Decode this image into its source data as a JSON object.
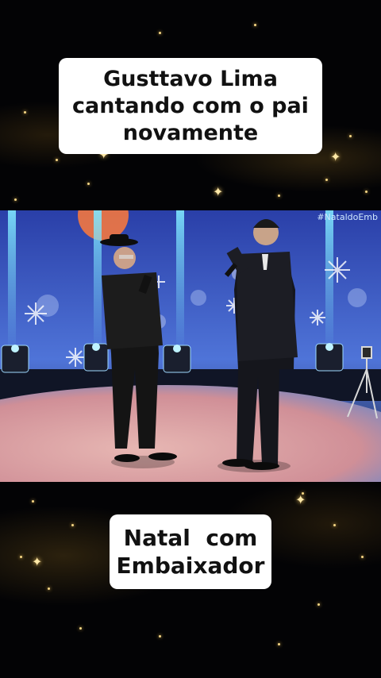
{
  "captions": {
    "top": "Gusttavo Lima cantando com o pai novamente",
    "bottom": "Natal  com Embaixador"
  },
  "scene": {
    "hashtag": "#NataldoEmb"
  },
  "colors": {
    "background": "#030305",
    "caption_bg": "#ffffff",
    "caption_text": "#111111",
    "sparkle": "#f7d785",
    "stage_floor": "#d9a2a6",
    "stage_backdrop": "#3f5fd0"
  }
}
